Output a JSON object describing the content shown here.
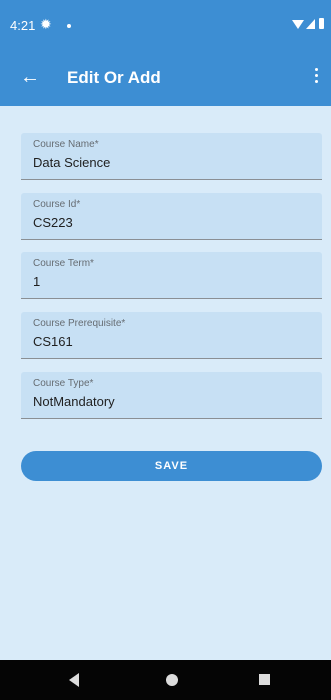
{
  "status_bar": {
    "time": "4:21",
    "icons": [
      "gear-icon",
      "notification-dot-icon",
      "wifi-icon",
      "signal-icon",
      "battery-icon"
    ]
  },
  "app_bar": {
    "back_icon": "arrow-left-icon",
    "title": "Edit Or Add",
    "menu_icon": "more-vert-icon"
  },
  "form": {
    "fields": [
      {
        "label": "Course Name*",
        "value": "Data Science"
      },
      {
        "label": "Course Id*",
        "value": "CS223"
      },
      {
        "label": "Course Term*",
        "value": "1"
      },
      {
        "label": "Course Prerequisite*",
        "value": "CS161"
      },
      {
        "label": "Course Type*",
        "value": "NotMandatory"
      }
    ],
    "save_label": "SAVE"
  },
  "nav_bar": {
    "icons": [
      "back-triangle-icon",
      "home-circle-icon",
      "recents-square-icon"
    ]
  },
  "colors": {
    "primary": "#3d8ed3",
    "background": "#d9ebf9",
    "field_background": "#c7e0f4",
    "nav_bar": "#050505"
  }
}
